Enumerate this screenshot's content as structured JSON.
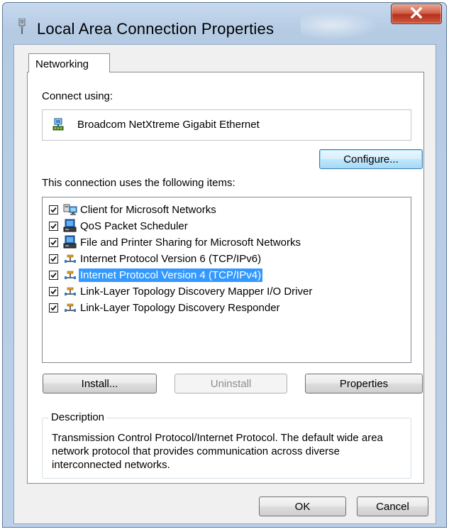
{
  "window": {
    "title": "Local Area Connection Properties",
    "close_label": "X"
  },
  "tabs": [
    {
      "label": "Networking",
      "active": true
    }
  ],
  "connect_using": {
    "label": "Connect using:",
    "adapter_name": "Broadcom NetXtreme Gigabit Ethernet",
    "adapter_icon": "network-adapter-icon"
  },
  "buttons": {
    "configure": "Configure...",
    "install": "Install...",
    "uninstall": "Uninstall",
    "properties": "Properties",
    "ok": "OK",
    "cancel": "Cancel"
  },
  "items_label": "This connection uses the following items:",
  "items": [
    {
      "label": "Client for Microsoft Networks",
      "checked": true,
      "icon": "network-client-icon",
      "selected": false
    },
    {
      "label": "QoS Packet Scheduler",
      "checked": true,
      "icon": "network-service-icon",
      "selected": false
    },
    {
      "label": "File and Printer Sharing for Microsoft Networks",
      "checked": true,
      "icon": "network-service-icon",
      "selected": false
    },
    {
      "label": "Internet Protocol Version 6 (TCP/IPv6)",
      "checked": true,
      "icon": "network-protocol-icon",
      "selected": false
    },
    {
      "label": "Internet Protocol Version 4 (TCP/IPv4)",
      "checked": true,
      "icon": "network-protocol-icon",
      "selected": true
    },
    {
      "label": "Link-Layer Topology Discovery Mapper I/O Driver",
      "checked": true,
      "icon": "network-protocol-icon",
      "selected": false
    },
    {
      "label": "Link-Layer Topology Discovery Responder",
      "checked": true,
      "icon": "network-protocol-icon",
      "selected": false
    }
  ],
  "description": {
    "legend": "Description",
    "text": "Transmission Control Protocol/Internet Protocol. The default wide area network protocol that provides communication across diverse interconnected networks."
  },
  "colors": {
    "selection": "#3399ff",
    "close_button": "#c7432a",
    "title_bar": "#bcd0e7"
  }
}
